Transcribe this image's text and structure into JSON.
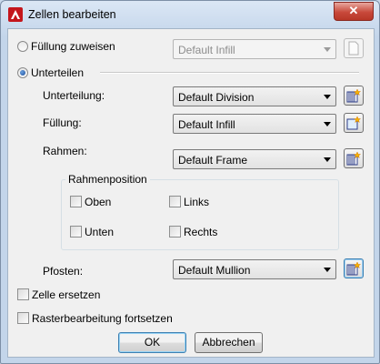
{
  "window": {
    "title": "Zellen bearbeiten",
    "close_symbol": "✕"
  },
  "fill_assign": {
    "label": "Füllung zuweisen",
    "selected": false,
    "combo_value": "Default Infill",
    "enabled": false
  },
  "subdivide": {
    "label": "Unterteilen",
    "selected": true,
    "fields": [
      {
        "label": "Unterteilung:",
        "value": "Default Division"
      },
      {
        "label": "Füllung:",
        "value": "Default Infill"
      },
      {
        "label": "Rahmen:",
        "value": "Default Frame"
      }
    ],
    "frame_position": {
      "title": "Rahmenposition",
      "options": [
        {
          "label": "Oben",
          "checked": false
        },
        {
          "label": "Links",
          "checked": false
        },
        {
          "label": "Unten",
          "checked": false
        },
        {
          "label": "Rechts",
          "checked": false
        }
      ]
    },
    "mullion": {
      "label": "Pfosten:",
      "value": "Default Mullion"
    }
  },
  "replace_cell": {
    "label": "Zelle ersetzen",
    "checked": false
  },
  "continue_grid": {
    "label": "Rasterbearbeitung fortsetzen",
    "checked": false
  },
  "buttons": {
    "ok": "OK",
    "cancel": "Abbrechen"
  }
}
